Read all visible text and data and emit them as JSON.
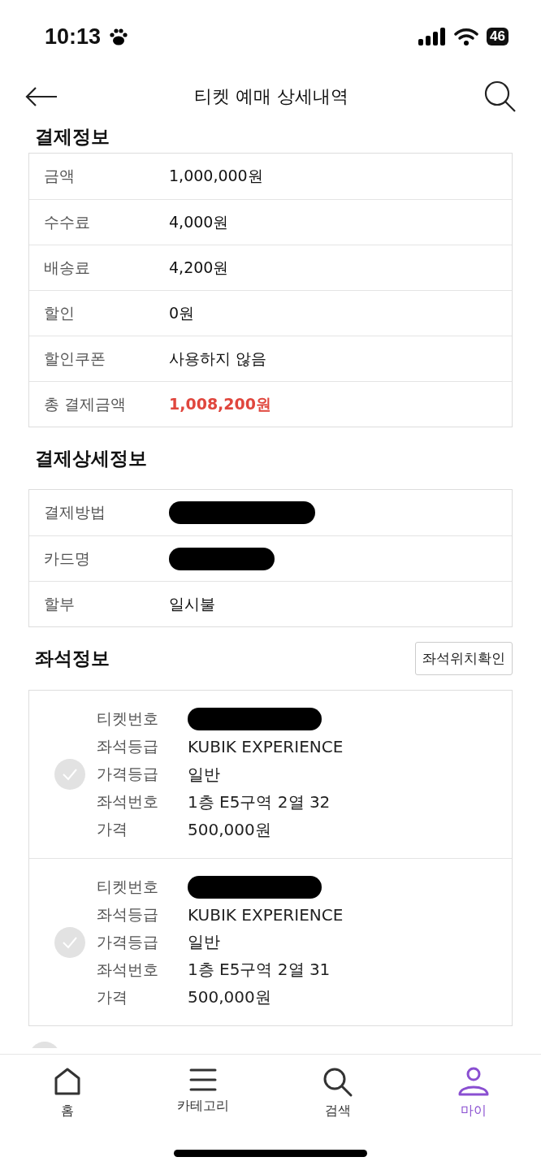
{
  "status_bar": {
    "time": "10:13",
    "battery": "46"
  },
  "header": {
    "title": "티켓 예매 상세내역"
  },
  "payment": {
    "title": "결제정보",
    "rows": [
      {
        "label": "금액",
        "value": "1,000,000원",
        "highlight": false
      },
      {
        "label": "수수료",
        "value": "4,000원",
        "highlight": false
      },
      {
        "label": "배송료",
        "value": "4,200원",
        "highlight": false
      },
      {
        "label": "할인",
        "value": "0원",
        "highlight": false
      },
      {
        "label": "할인쿠폰",
        "value": "사용하지 않음",
        "highlight": false
      },
      {
        "label": "총 결제금액",
        "value": "1,008,200원",
        "highlight": true
      }
    ]
  },
  "payment_detail": {
    "title": "결제상세정보",
    "rows": [
      {
        "label": "결제방법",
        "redacted": true
      },
      {
        "label": "카드명",
        "redacted": true
      },
      {
        "label": "할부",
        "value": "일시불",
        "redacted": false
      }
    ]
  },
  "seats": {
    "title": "좌석정보",
    "button": "좌석위치확인",
    "tickets": [
      {
        "selected": false,
        "fields": [
          {
            "label": "티켓번호",
            "redacted": true
          },
          {
            "label": "좌석등급",
            "value": "KUBIK EXPERIENCE",
            "redacted": false
          },
          {
            "label": "가격등급",
            "value": "일반",
            "redacted": false
          },
          {
            "label": "좌석번호",
            "value": "1층 E5구역 2열 32",
            "redacted": false
          },
          {
            "label": "가격",
            "value": "500,000원",
            "redacted": false
          }
        ]
      },
      {
        "selected": false,
        "fields": [
          {
            "label": "티켓번호",
            "redacted": true
          },
          {
            "label": "좌석등급",
            "value": "KUBIK EXPERIENCE",
            "redacted": false
          },
          {
            "label": "가격등급",
            "value": "일반",
            "redacted": false
          },
          {
            "label": "좌석번호",
            "value": "1층 E5구역 2열 31",
            "redacted": false
          },
          {
            "label": "가격",
            "value": "500,000원",
            "redacted": false
          }
        ]
      }
    ]
  },
  "nav": [
    {
      "kind": "home",
      "label": "홈",
      "selected": false
    },
    {
      "kind": "menu",
      "label": "카테고리",
      "selected": false
    },
    {
      "kind": "search",
      "label": "검색",
      "selected": false
    },
    {
      "kind": "user",
      "label": "마이",
      "selected": true
    }
  ]
}
